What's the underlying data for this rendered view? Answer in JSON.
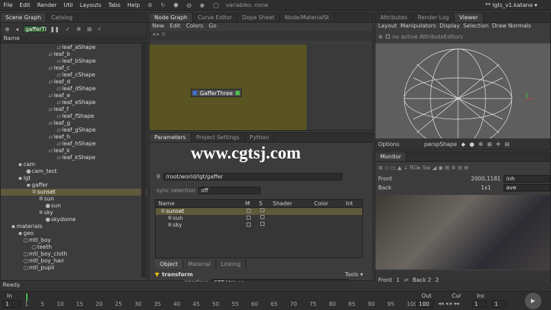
{
  "menubar": {
    "items": [
      "File",
      "Edit",
      "Render",
      "Util",
      "Layouts",
      "Tabs",
      "Help"
    ],
    "variables": "variables: none",
    "file_title": "** lgts_v1.katana ▾"
  },
  "scene_graph": {
    "tabs": [
      "Scene Graph",
      "Catalog"
    ],
    "filter": "gafferTl",
    "column": "Name",
    "rows": [
      "leaf_aShape",
      "leaf_b",
      "leaf_bShape",
      "leaf_c",
      "leaf_cShape",
      "leaf_d",
      "leaf_dShape",
      "leaf_e",
      "leaf_eShape",
      "leaf_f",
      "leaf_fShape",
      "leaf_g",
      "leaf_gShape",
      "leaf_h",
      "leaf_hShape",
      "leaf_k",
      "leaf_kShape",
      "cam",
      "cam_test",
      "lgt",
      "gaffer",
      "sunset",
      "sun",
      "sun",
      "sky",
      "skydome",
      "materials",
      "geo",
      "mtl_boy",
      "teeth",
      "mtl_boy_cloth",
      "mtl_boy_hair",
      "mtl_pupil"
    ]
  },
  "node_graph": {
    "tabs": [
      "Node Graph",
      "Curve Editor",
      "Dope Sheet",
      "Node/MaterialSt"
    ],
    "menu": [
      "New",
      "Edit",
      "Colors",
      "Go"
    ],
    "node": "GafferThree"
  },
  "viewer": {
    "tabs": [
      "Attributes",
      "Render Log",
      "Viewer"
    ],
    "menu": [
      "Layout",
      "Manipulators",
      "Display",
      "Selection",
      "Draw Normals"
    ],
    "msg": "no active AttributeEditors",
    "options": "Options",
    "camera": "perspShape"
  },
  "parameters": {
    "tabs": [
      "Parameters",
      "Project Settings",
      "Python"
    ],
    "path": "/root/world/lgt/gaffer",
    "sync_label": "sync selection",
    "sync_value": "off",
    "columns": [
      "Name",
      "M",
      "S",
      "Shader",
      "Color",
      "Int"
    ],
    "rows": [
      "sunset",
      "sun",
      "sky"
    ],
    "subtabs": [
      "Object",
      "Material",
      "Linking"
    ],
    "section": "transform",
    "tools": "Tools ▾",
    "interface_label": "interface",
    "interface_value": "SRT Values",
    "watermark": "www.cgtsj.com"
  },
  "monitor": {
    "tabs": [
      "Monitor"
    ],
    "front": "Front",
    "back": "Back",
    "res": "2000,1181",
    "res_unit": "inh",
    "ratio": "1x1",
    "mode": "ave",
    "front_label": "Front",
    "front_val": "1",
    "back_label": "Back 2",
    "back_val": "2"
  },
  "status": {
    "text": "Ready."
  },
  "timeline": {
    "in_label": "In",
    "in_val": "1",
    "out_label": "Out",
    "out_val": "100",
    "cur_label": "Cur",
    "cur_val": "1",
    "inc_label": "Inc",
    "inc_val": "1",
    "ticks": [
      "1",
      "5",
      "10",
      "15",
      "20",
      "25",
      "30",
      "35",
      "40",
      "45",
      "50",
      "55",
      "60",
      "65",
      "70",
      "75",
      "80",
      "85",
      "90",
      "95",
      "100"
    ]
  },
  "colors": {
    "node_bg": "#5a5422",
    "selection": "#5e5a3a",
    "node_green": "#4fbf4f",
    "node_blue": "#3c6fd0",
    "accent": "#f2c500"
  }
}
